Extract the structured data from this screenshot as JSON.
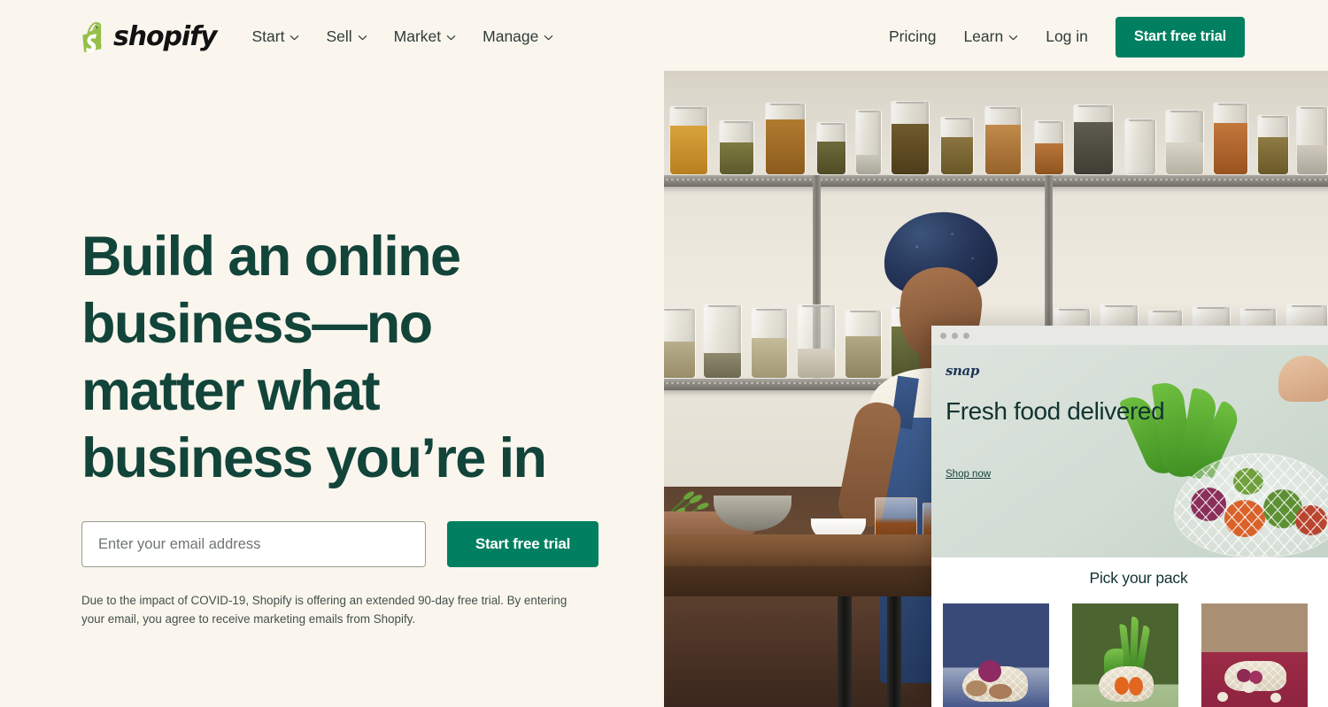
{
  "brand": {
    "name": "shopify",
    "logo_icon": "shopify-bag-icon",
    "green": "#008060",
    "dark_green": "#12443a",
    "cream_bg": "#faf6ed"
  },
  "header": {
    "nav_items": [
      {
        "label": "Start",
        "icon": "chevron-down-icon"
      },
      {
        "label": "Sell",
        "icon": "chevron-down-icon"
      },
      {
        "label": "Market",
        "icon": "chevron-down-icon"
      },
      {
        "label": "Manage",
        "icon": "chevron-down-icon"
      }
    ],
    "right_items": [
      {
        "label": "Pricing",
        "has_chevron": false
      },
      {
        "label": "Learn",
        "has_chevron": true
      },
      {
        "label": "Log in",
        "has_chevron": false
      }
    ],
    "cta_label": "Start free trial"
  },
  "hero": {
    "headline": "Build an online business—no matter what business you’re in",
    "email_placeholder": "Enter your email address",
    "email_value": "",
    "cta_label": "Start free trial",
    "disclaimer": "Due to the impact of COVID-19, Shopify is offering an extended 90-day free trial. By entering your email, you agree to receive marketing emails from Shopify."
  },
  "storefront": {
    "browser_dots": 3,
    "logo": "snap",
    "headline": "Fresh food delivered",
    "link_label": "Shop now",
    "section_title": "Pick your pack",
    "packs": [
      {
        "name": "pack-card-blue",
        "bg": "#3a4a78"
      },
      {
        "name": "pack-card-green",
        "bg": "#4c6430"
      },
      {
        "name": "pack-card-crimson",
        "bg": "#9c2b46"
      }
    ]
  }
}
